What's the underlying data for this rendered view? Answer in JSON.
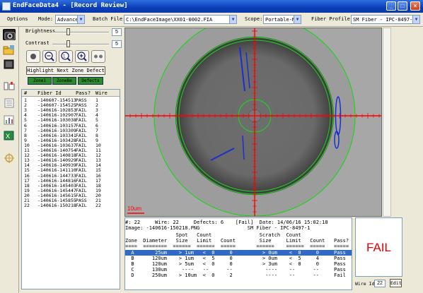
{
  "window": {
    "title": "EndFaceData4 - [Record Review]",
    "min_glyph": "_",
    "max_glyph": "□",
    "close_glyph": "×"
  },
  "topbar": {
    "options_label": "Options",
    "mode_label": "Mode:",
    "mode_value": "Advanced",
    "batch_label": "Batch File:",
    "batch_path": "C:\\EndFaceImage\\XX01-0002.FIA",
    "scope_label": "Scope:",
    "scope_value": "Portable-N",
    "fiber_profile_label": "Fiber Profile:",
    "fiber_profile_value": "SM Fiber - IPC-8497-1"
  },
  "controls": {
    "brightness_label": "Brightness",
    "brightness_value": "5",
    "contrast_label": "Contrast",
    "contrast_value": "5",
    "highlight_button": "Highlight Next Zone Defect",
    "zone_buttons": [
      "Zone1",
      "ZoneBe",
      "Defects"
    ]
  },
  "fiber_list": {
    "headers": [
      "#",
      "Fiber Id",
      "Pass?",
      "Wire"
    ],
    "rows": [
      [
        "1",
        "-140607-154513",
        "PASS",
        "1"
      ],
      [
        "2",
        "-140607-154525",
        "PASS",
        "2"
      ],
      [
        "3",
        "-140616-102853",
        "FAIL",
        "3"
      ],
      [
        "4",
        "-140616-102907",
        "FAIL",
        "4"
      ],
      [
        "5",
        "-140616-103038",
        "FAIL",
        "5"
      ],
      [
        "6",
        "-140616-103157",
        "FAIL",
        "6"
      ],
      [
        "7",
        "-140616-103309",
        "FAIL",
        "7"
      ],
      [
        "8",
        "-140616-103341",
        "FAIL",
        "8"
      ],
      [
        "9",
        "-140616-103428",
        "FAIL",
        "9"
      ],
      [
        "10",
        "-140616-103637",
        "FAIL",
        "10"
      ],
      [
        "11",
        "-140616-140754",
        "FAIL",
        "11"
      ],
      [
        "12",
        "-140616-140818",
        "FAIL",
        "12"
      ],
      [
        "13",
        "-140616-140929",
        "FAIL",
        "13"
      ],
      [
        "14",
        "-140616-140939",
        "FAIL",
        "14"
      ],
      [
        "15",
        "-140616-141110",
        "FAIL",
        "15"
      ],
      [
        "16",
        "-140616-144733",
        "FAIL",
        "16"
      ],
      [
        "17",
        "-140616-144816",
        "FAIL",
        "17"
      ],
      [
        "18",
        "-140616-145403",
        "FAIL",
        "18"
      ],
      [
        "19",
        "-140616-145447",
        "FAIL",
        "19"
      ],
      [
        "20",
        "-140616-145615",
        "FAIL",
        "20"
      ],
      [
        "21",
        "-140616-145855",
        "PASS",
        "21"
      ],
      [
        "22",
        "-140616-150218",
        "FAIL",
        "22"
      ]
    ]
  },
  "viewer": {
    "scale_label": "10um"
  },
  "report": {
    "line1": "#: 22     Wire: 22     Defects: 6    [Fail]  Date: 14/06/16 15:02:18",
    "line2": "Image: -140616-150218.PNG                SM Fiber - IPC-8497-1",
    "header1": "                 Spot   Count                Scratch  Count",
    "header2": "Zone  Diameter   Size   Limit   Count        Size     Limit   Count   Pass?",
    "sep": "====  ========  ======  ======  =====       ======    ======  =====   =====",
    "rows": [
      "  A       25um    > 1um   <  0     0          > 0um    <  0     0     Pass",
      "  B      120um    > 1um   <  5     0          > 0um    <  5     4     Pass",
      "  B      120um    > 5um   <  0     0          > 3um    <  0     0     Pass",
      "  C      130um     ----   --      --           ----    --      --     Pass",
      "  D      250um    > 10um  <  0     2           ----    --      --     Fail"
    ],
    "selected_row": 0
  },
  "result": {
    "status": "FAIL",
    "wire_label": "Wire Id",
    "wire_id": "22",
    "edit_button": "Edit"
  },
  "colors": {
    "fail_red": "#e00000",
    "selection_blue": "#316ac5",
    "overlay_red": "#ff0000",
    "overlay_green": "#22cc22",
    "scratch_blue": "#1a2fd0"
  }
}
